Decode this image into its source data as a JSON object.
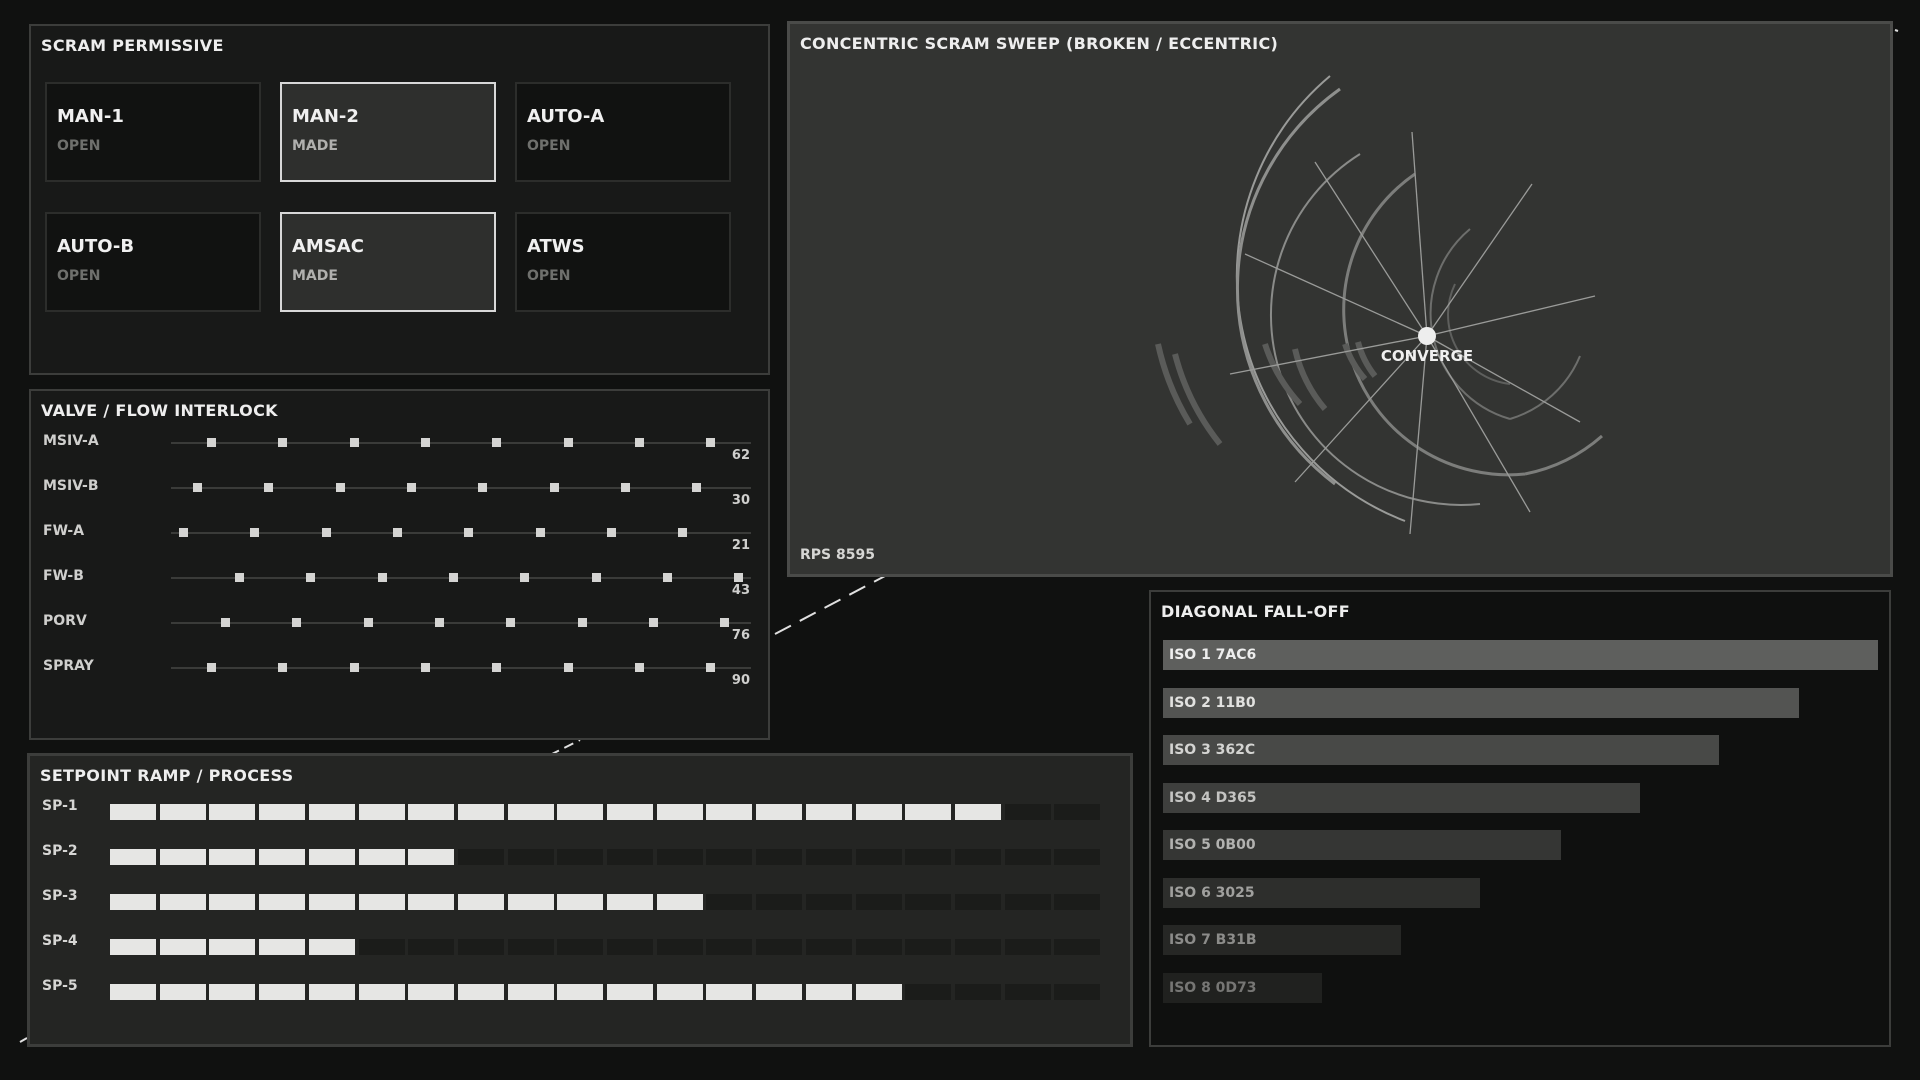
{
  "scram": {
    "title": "SCRAM PERMISSIVE",
    "tiles": [
      {
        "name": "MAN-1",
        "state": "OPEN"
      },
      {
        "name": "MAN-2",
        "state": "MADE"
      },
      {
        "name": "AUTO-A",
        "state": "OPEN"
      },
      {
        "name": "AUTO-B",
        "state": "OPEN"
      },
      {
        "name": "AMSAC",
        "state": "MADE"
      },
      {
        "name": "ATWS",
        "state": "OPEN"
      }
    ]
  },
  "valve": {
    "title": "VALVE / FLOW INTERLOCK",
    "rows": [
      {
        "label": "MSIV-A",
        "value": "62"
      },
      {
        "label": "MSIV-B",
        "value": "30"
      },
      {
        "label": "FW-A",
        "value": "21"
      },
      {
        "label": "FW-B",
        "value": "43"
      },
      {
        "label": "PORV",
        "value": "76"
      },
      {
        "label": "SPRAY",
        "value": "90"
      }
    ]
  },
  "sweep": {
    "title": "CONCENTRIC SCRAM SWEEP  (BROKEN / ECCENTRIC)",
    "center_label": "CONVERGE",
    "status": "RPS 8595"
  },
  "ramp": {
    "title": "SETPOINT RAMP  /  PROCESS",
    "total_segments": 20,
    "rows": [
      {
        "label": "SP-1",
        "filled": 18
      },
      {
        "label": "SP-2",
        "filled": 7
      },
      {
        "label": "SP-3",
        "filled": 12
      },
      {
        "label": "SP-4",
        "filled": 5
      },
      {
        "label": "SP-5",
        "filled": 16
      }
    ]
  },
  "falloff": {
    "title": "DIAGONAL FALL-OFF",
    "bars": [
      {
        "label": "ISO 1  7AC6",
        "fraction": 1.0,
        "color": "#5e5f5d",
        "text_color": "#eeeeee"
      },
      {
        "label": "ISO 2  11B0",
        "fraction": 0.889,
        "color": "#535452",
        "text_color": "#e2e2e0"
      },
      {
        "label": "ISO 3  362C",
        "fraction": 0.778,
        "color": "#484947",
        "text_color": "#d4d4d2"
      },
      {
        "label": "ISO 4  D365",
        "fraction": 0.667,
        "color": "#3e3f3d",
        "text_color": "#c4c4c2"
      },
      {
        "label": "ISO 5  0B00",
        "fraction": 0.556,
        "color": "#353634",
        "text_color": "#b2b2b0"
      },
      {
        "label": "ISO 6  3025",
        "fraction": 0.444,
        "color": "#2d2e2c",
        "text_color": "#a0a09e"
      },
      {
        "label": "ISO 7  B31B",
        "fraction": 0.333,
        "color": "#262725",
        "text_color": "#8c8c8a"
      },
      {
        "label": "ISO 8  0D73",
        "fraction": 0.222,
        "color": "#20211f",
        "text_color": "#767674"
      }
    ]
  }
}
